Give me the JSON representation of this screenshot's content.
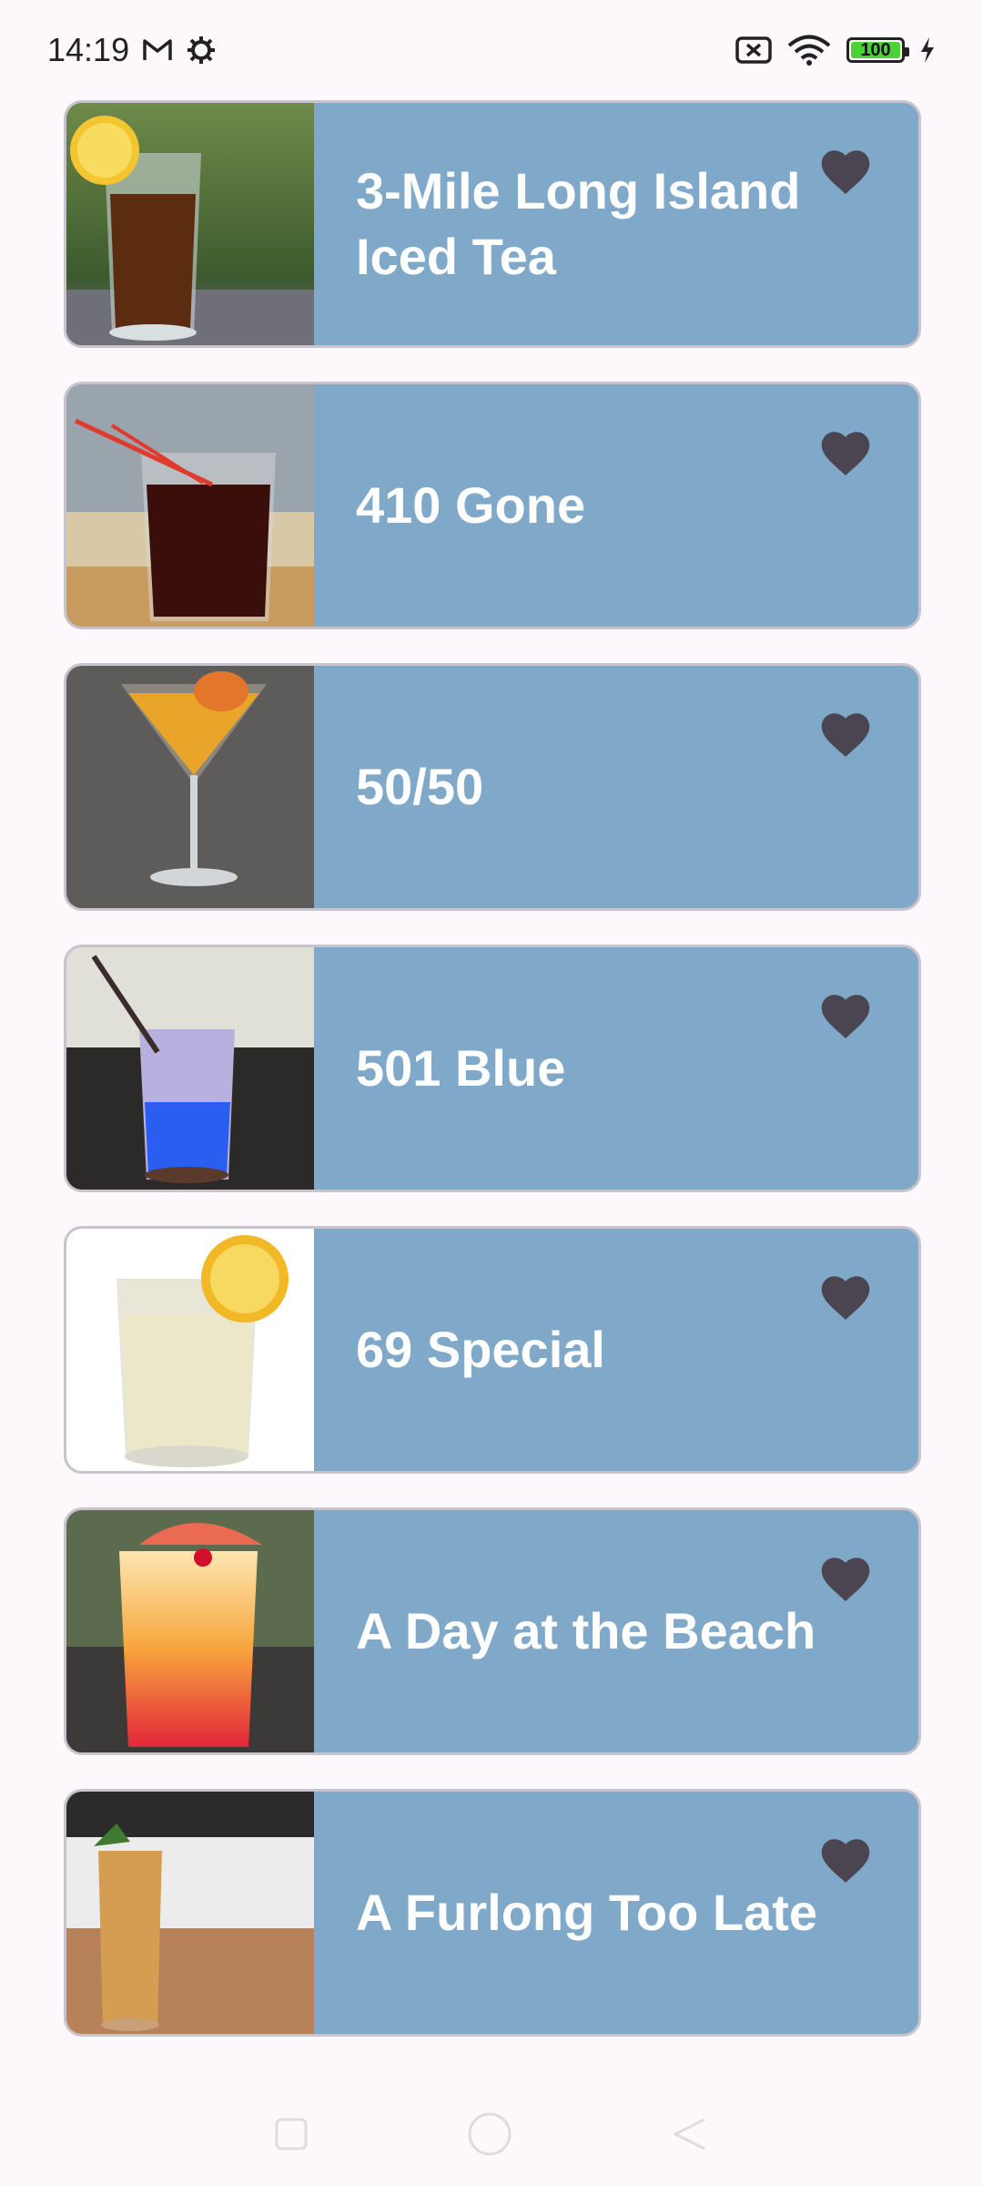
{
  "status": {
    "time": "14:19",
    "battery": "100",
    "icons": [
      "gmail-icon",
      "settings-gear-icon",
      "no-sim-icon",
      "wifi-icon",
      "battery-icon",
      "charging-bolt-icon"
    ]
  },
  "drinks": [
    {
      "name": "3-Mile Long Island Iced Tea",
      "favorite_icon": "heart-icon"
    },
    {
      "name": "410 Gone",
      "favorite_icon": "heart-icon"
    },
    {
      "name": "50/50",
      "favorite_icon": "heart-icon"
    },
    {
      "name": "501 Blue",
      "favorite_icon": "heart-icon"
    },
    {
      "name": "69 Special",
      "favorite_icon": "heart-icon"
    },
    {
      "name": "A Day at the Beach",
      "favorite_icon": "heart-icon"
    },
    {
      "name": "A Furlong Too Late",
      "favorite_icon": "heart-icon"
    }
  ],
  "colors": {
    "card_bg": "#7fa8c9",
    "heart": "#4a4550",
    "title_text": "#ffffff",
    "page_bg": "#fdf8fc"
  },
  "nav": [
    "recents-button",
    "home-button",
    "back-button"
  ]
}
